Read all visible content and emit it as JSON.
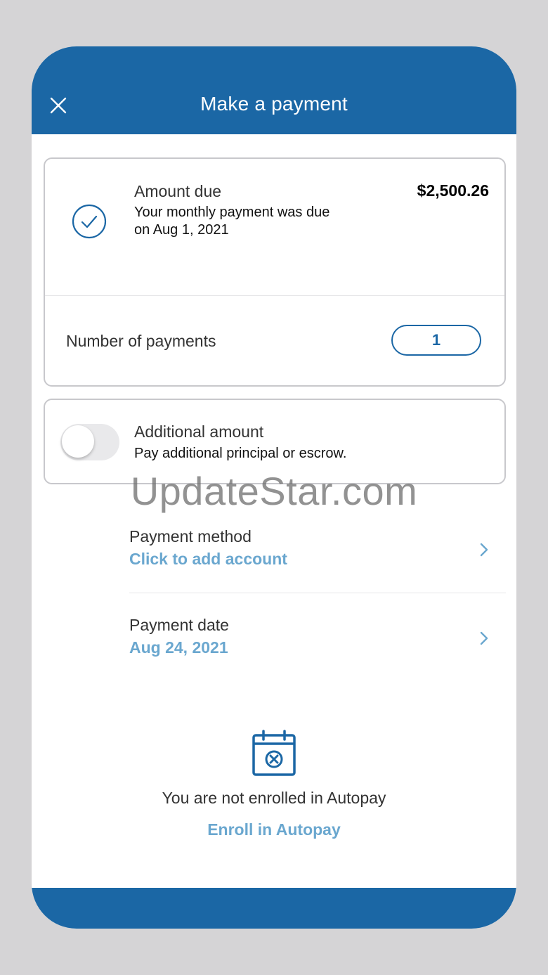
{
  "header": {
    "title": "Make a payment"
  },
  "amount_due": {
    "label": "Amount due",
    "amount": "$2,500.26",
    "description": "Your monthly payment was due on Aug 1, 2021"
  },
  "number_of_payments": {
    "label": "Number of payments",
    "value": "1"
  },
  "additional_amount": {
    "label": "Additional amount",
    "description": "Pay additional principal or escrow.",
    "toggle_on": false
  },
  "watermark": "UpdateStar.com",
  "payment_method": {
    "label": "Payment method",
    "value": "Click to add account"
  },
  "payment_date": {
    "label": "Payment date",
    "value": "Aug 24, 2021"
  },
  "autopay": {
    "status_text": "You are not enrolled in Autopay",
    "enroll_label": "Enroll in Autopay"
  },
  "colors": {
    "brand": "#1b67a5",
    "link": "#6aa7cf",
    "background": "#d5d4d6"
  },
  "icons": [
    "close-icon",
    "check-circle-icon",
    "chevron-right-icon",
    "calendar-cancel-icon"
  ]
}
